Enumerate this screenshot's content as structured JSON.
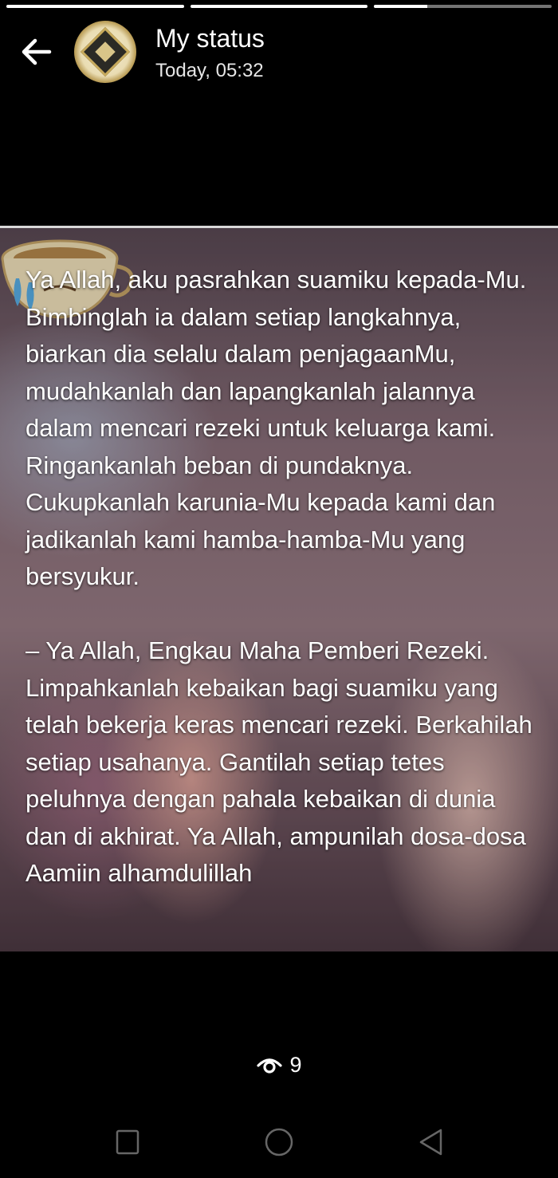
{
  "progress": [
    1.0,
    1.0,
    0.3
  ],
  "header": {
    "title": "My status",
    "time": "Today, 05:32"
  },
  "status": {
    "text": "Ya Allah, aku pasrahkan suamiku kepada-Mu. Bimbinglah ia dalam setiap langkahnya, biarkan dia selalu dalam penjagaanMu, mudahkanlah dan lapangkanlah jalannya dalam mencari rezeki untuk keluarga kami. Ringankanlah beban di pundaknya. Cukupkanlah karunia-Mu kepada kami dan jadikanlah kami hamba-hamba-Mu yang bersyukur.\n\n– Ya Allah, Engkau Maha Pemberi Rezeki. Limpahkanlah kebaikan bagi suamiku yang telah bekerja keras mencari rezeki. Berkahilah setiap usahanya. Gantilah setiap tetes peluhnya dengan pahala kebaikan di dunia dan di akhirat. Ya Allah, ampunilah dosa-dosa  Aamiin alhamdulillah"
  },
  "views": {
    "count": "9",
    "icon": "eye-icon"
  },
  "navbar": {
    "icons": [
      "recents-icon",
      "home-icon",
      "back-triangle-icon"
    ]
  }
}
